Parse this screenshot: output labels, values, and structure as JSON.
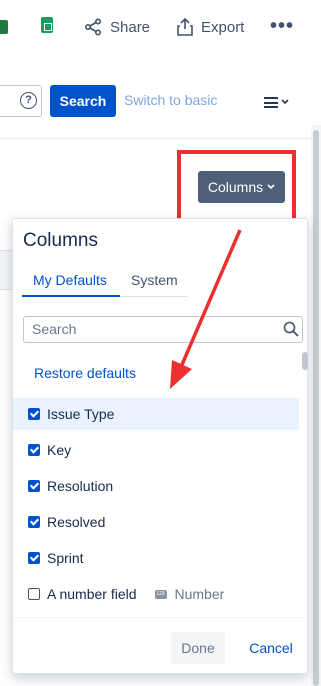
{
  "toolbar": {
    "excel_icon": "excel-icon",
    "sheets_icon": "google-sheets-icon",
    "share_label": "Share",
    "export_label": "Export",
    "more_label": "•••"
  },
  "search_row": {
    "help_label": "?",
    "search_button": "Search",
    "switch_link": "Switch to basic"
  },
  "columns_button": {
    "label": "Columns",
    "icon": "chevron-down-icon"
  },
  "popup": {
    "title": "Columns",
    "tabs": [
      {
        "label": "My Defaults",
        "active": true
      },
      {
        "label": "System",
        "active": false
      }
    ],
    "search_placeholder": "Search",
    "search_value": "",
    "restore_label": "Restore defaults",
    "items": [
      {
        "label": "Issue Type",
        "checked": true,
        "highlighted": true
      },
      {
        "label": "Key",
        "checked": true
      },
      {
        "label": "Resolution",
        "checked": true
      },
      {
        "label": "Resolved",
        "checked": true
      },
      {
        "label": "Sprint",
        "checked": true
      },
      {
        "label": "A number field",
        "checked": false,
        "type_badge": "123",
        "type_label": "Number"
      }
    ],
    "done_label": "Done",
    "cancel_label": "Cancel"
  },
  "colors": {
    "primary": "#0052cc",
    "annotation_red": "#ec2f2f",
    "columns_button_bg": "#505f79"
  }
}
